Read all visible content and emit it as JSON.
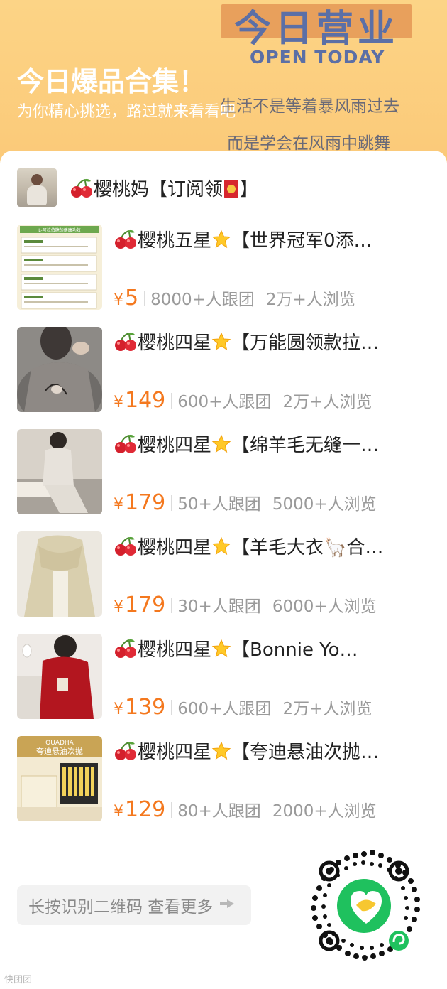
{
  "banner": {
    "badge": "今日营业",
    "open": "OPEN TODAY",
    "title": "今日爆品合集！",
    "subtitle": "为你精心挑选，路过就来看看吧",
    "quote_line1": "生活不是等着暴风雨过去",
    "quote_line2": "而是学会在风雨中跳舞"
  },
  "shop": {
    "name_prefix": "樱桃妈【订阅领",
    "name_suffix": "】"
  },
  "items": [
    {
      "title_prefix": "樱桃五星",
      "title_rest": "【世界冠军0添…",
      "price_symbol": "¥",
      "price": "5",
      "group": "8000+人跟团",
      "views": "2万+人浏览"
    },
    {
      "title_prefix": "樱桃四星",
      "title_rest": "【万能圆领款拉…",
      "price_symbol": "¥",
      "price": "149",
      "group": "600+人跟团",
      "views": "2万+人浏览"
    },
    {
      "title_prefix": "樱桃四星",
      "title_rest": "【绵羊毛无缝一…",
      "price_symbol": "¥",
      "price": "179",
      "group": "50+人跟团",
      "views": "5000+人浏览"
    },
    {
      "title_prefix": "樱桃四星",
      "title_rest": "【羊毛大衣🦙合…",
      "price_symbol": "¥",
      "price": "179",
      "group": "30+人跟团",
      "views": "6000+人浏览"
    },
    {
      "title_prefix": "樱桃四星",
      "title_rest": "【Bonnie Yo…",
      "price_symbol": "¥",
      "price": "139",
      "group": "600+人跟团",
      "views": "2万+人浏览"
    },
    {
      "title_prefix": "樱桃四星",
      "title_rest": "【夸迪悬油次抛…",
      "price_symbol": "¥",
      "price": "129",
      "group": "80+人跟团",
      "views": "2000+人浏览"
    }
  ],
  "thumb_text": {
    "item0": "L-阿拉伯糖的健康功效",
    "item5_brand": "QUADHA",
    "item5_name": "夸迪悬油次抛"
  },
  "more_button": {
    "label": "长按识别二维码 查看更多"
  },
  "footer": {
    "watermark": "快团团"
  },
  "icons": {
    "cherry": "cherry-icon",
    "star": "glowing-star-icon",
    "envelope": "red-envelope-icon",
    "arrow": "hand-pointer-icon",
    "qr": "mini-program-qr-code"
  },
  "colors": {
    "banner_bg": "#fcd486",
    "price": "#f4781e",
    "muted": "#9a9a9a",
    "qr_green": "#1fc15e"
  }
}
